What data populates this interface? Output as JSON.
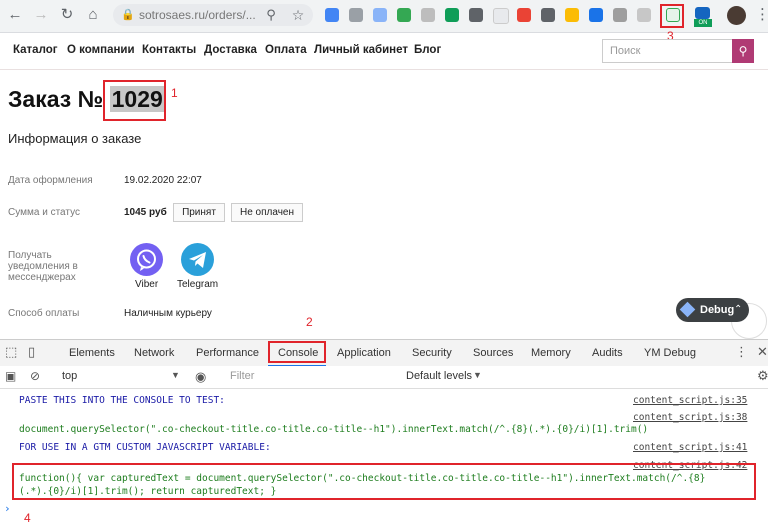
{
  "browser": {
    "url": "sotrosaes.ru/orders/...",
    "colors": {
      "toolbar_bg": "#f1f3f4"
    }
  },
  "site_nav": {
    "links": [
      "Каталог",
      "О компании",
      "Контакты",
      "Доставка",
      "Оплата",
      "Личный кабинет",
      "Блог"
    ],
    "search_placeholder": "Поиск",
    "search_button_color": "#b03a74"
  },
  "order": {
    "title_prefix": "Заказ №",
    "number": "1029",
    "info_heading": "Информация о заказе",
    "date_label": "Дата оформления",
    "date_value": "19.02.2020 22:07",
    "sum_label": "Сумма и статус",
    "sum_value": "1045 руб",
    "status_accepted": "Принят",
    "status_unpaid": "Не оплачен",
    "notify_label_1": "Получать",
    "notify_label_2": "уведомления в",
    "notify_label_3": "мессенджерах",
    "viber": "Viber",
    "telegram": "Telegram",
    "payment_label": "Способ оплаты",
    "payment_value": "Наличным курьеру",
    "debug_badge": "Debug"
  },
  "annotations": {
    "one": "1",
    "two": "2",
    "three": "3",
    "four": "4",
    "color": "#e0242b"
  },
  "devtools": {
    "tabs": [
      "Elements",
      "Network",
      "Performance",
      "Console",
      "Application",
      "Security",
      "Sources",
      "Memory",
      "Audits",
      "YM Debug"
    ],
    "active_tab": "Console",
    "context": "top",
    "filter_placeholder": "Filter",
    "levels": "Default levels"
  },
  "console": {
    "line1": "PASTE THIS INTO THE CONSOLE TO TEST:",
    "src1": "content_script.js:35",
    "src2": "content_script.js:38",
    "line2": "document.querySelector(\".co-checkout-title.co-title.co-title--h1\").innerText.match(/^.{8}(.*).{0}/i)[1].trim()",
    "line3": "FOR USE IN A GTM CUSTOM JAVASCRIPT VARIABLE:",
    "src3": "content_script.js:41",
    "src4": "content_script.js:42",
    "line4": "function(){ var capturedText = document.querySelector(\".co-checkout-title.co-title.co-title--h1\").innerText.match(/^.{8}",
    "line5": "(.*).{0}/i)[1].trim(); return capturedText; }"
  }
}
